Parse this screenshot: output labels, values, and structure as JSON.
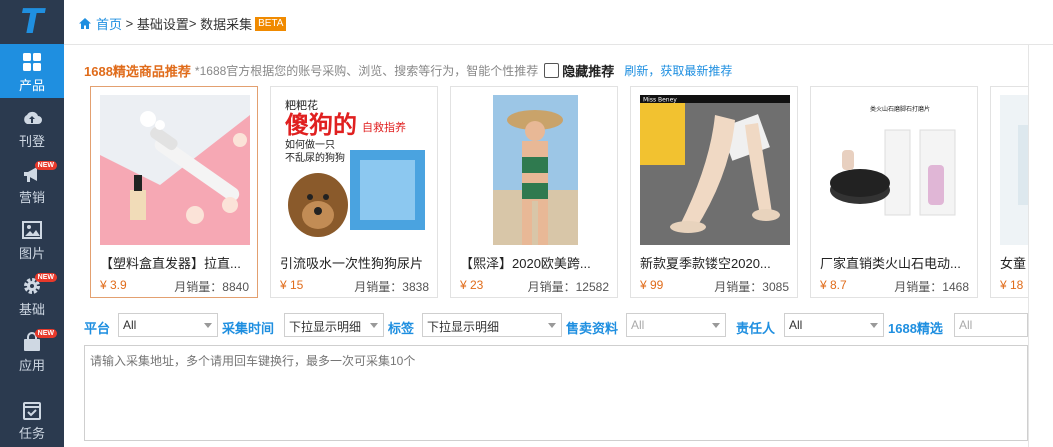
{
  "sidebar": {
    "logo": "T",
    "items": [
      {
        "label": "产品",
        "icon": "grid-icon",
        "active": true,
        "new": false
      },
      {
        "label": "刊登",
        "icon": "cloud-upload-icon",
        "active": false,
        "new": false
      },
      {
        "label": "营销",
        "icon": "megaphone-icon",
        "active": false,
        "new": true
      },
      {
        "label": "图片",
        "icon": "image-icon",
        "active": false,
        "new": false
      },
      {
        "label": "基础",
        "icon": "gear-icon",
        "active": false,
        "new": true
      },
      {
        "label": "应用",
        "icon": "bag-icon",
        "active": false,
        "new": true
      },
      {
        "label": "任务",
        "icon": "calendar-check-icon",
        "active": false,
        "new": false
      }
    ],
    "new_badge": "NEW"
  },
  "breadcrumb": {
    "home": "首页",
    "sep1": " > ",
    "level2": "基础设置",
    "sep2": "> ",
    "current": "数据采集",
    "badge": "BETA"
  },
  "recommend": {
    "title": "1688精选商品推荐",
    "note": "*1688官方根据您的账号采购、浏览、搜索等行为，智能个性推荐",
    "hide_label": "隐藏推荐",
    "refresh_label": "刷新，获取最新推荐",
    "products": [
      {
        "title": "【塑料盒直发器】拉直...",
        "price": "¥ 3.9",
        "sales": "月销量：8840"
      },
      {
        "title": "引流吸水一次性狗狗尿片",
        "price": "¥ 15",
        "sales": "月销量：3838"
      },
      {
        "title": "【熙泽】2020欧美跨...",
        "price": "¥ 23",
        "sales": "月销量：12582"
      },
      {
        "title": "新款夏季款镂空2020...",
        "price": "¥ 99",
        "sales": "月销量：3085"
      },
      {
        "title": "厂家直销类火山石电动...",
        "price": "¥ 8.7",
        "sales": "月销量：1468"
      },
      {
        "title": "女童",
        "price": "¥ 18",
        "sales": ""
      }
    ],
    "img_text": {
      "p2_top": "粑粑花",
      "p2_big": "傻狗的",
      "p2_side": "自救指养",
      "p2_q1": "如何做一只",
      "p2_q2": "不乱尿的狗狗",
      "p4_brand": "Miss Beney",
      "p5_head": "类火山石磨脚石打磨片"
    }
  },
  "filters": {
    "platform_label": "平台",
    "platform_value": "All",
    "time_label": "采集时间",
    "time_value": "下拉显示明细",
    "tag_label": "标签",
    "tag_value": "下拉显示明细",
    "sell_label": "售卖资料",
    "sell_value": "All",
    "owner_label": "责任人",
    "owner_value": "All",
    "pick_label": "1688精选",
    "pick_value": "All"
  },
  "url_input": {
    "placeholder": "请输入采集地址，多个请用回车键换行，最多一次可采集10个"
  }
}
